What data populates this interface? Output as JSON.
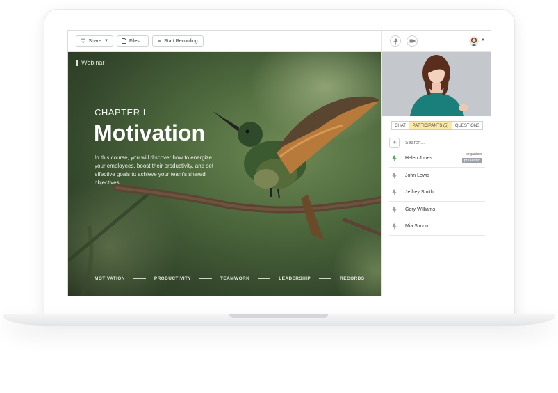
{
  "toolbar": {
    "share_label": "Share",
    "files_label": "Files",
    "record_label": "Start Recording"
  },
  "slide": {
    "label": "Webinar",
    "chapter": "CHAPTER I",
    "title": "Motivation",
    "description": "In this course, you will discover how to energize your employees, boost their productivity, and set effective goals to achieve your team's shared objectives.",
    "topics": [
      "MOTIVATION",
      "PRODUCTIVITY",
      "TEAMWORK",
      "LEADERSHIP",
      "RECORDS"
    ]
  },
  "panel": {
    "tabs": {
      "chat": "CHAT",
      "participants": "PARTICIPANTS (5)",
      "questions": "QUESTIONS"
    },
    "search_placeholder": "Search...",
    "participants": [
      {
        "name": "Helen Jones",
        "role": "organizer",
        "badge": "presenter",
        "mic": "active"
      },
      {
        "name": "John Lewis",
        "mic": "idle"
      },
      {
        "name": "Jeffrey Smith",
        "mic": "idle"
      },
      {
        "name": "Gery Williams",
        "mic": "idle"
      },
      {
        "name": "Mia Simon",
        "mic": "idle"
      }
    ]
  },
  "colors": {
    "active_mic": "#4caf50",
    "idle_mic": "#9aa0a6",
    "tab_active": "#fbe9a6"
  },
  "icons": [
    "monitor-icon",
    "file-icon",
    "record-icon",
    "microphone-icon",
    "camera-icon",
    "user-avatar",
    "chevron-down-icon"
  ]
}
